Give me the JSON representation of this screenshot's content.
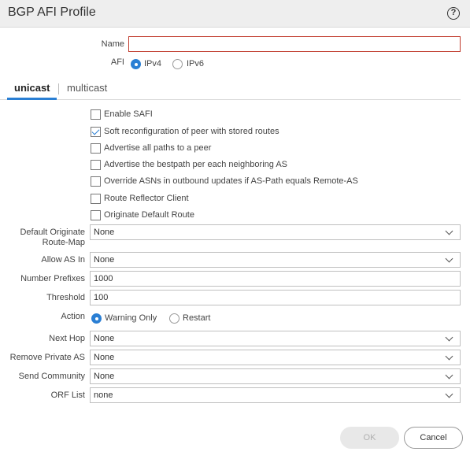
{
  "dialog": {
    "title": "BGP AFI Profile",
    "help_glyph": "?"
  },
  "form": {
    "name_label": "Name",
    "name_value": "",
    "afi_label": "AFI",
    "afi_options": [
      "IPv4",
      "IPv6"
    ],
    "afi_selected": "IPv4"
  },
  "tabs": [
    {
      "label": "unicast",
      "active": true
    },
    {
      "label": "multicast",
      "active": false
    }
  ],
  "checkboxes": [
    {
      "label": "Enable SAFI",
      "checked": false
    },
    {
      "label": "Soft reconfiguration of peer with stored routes",
      "checked": true
    },
    {
      "label": "Advertise all paths to a peer",
      "checked": false
    },
    {
      "label": "Advertise the bestpath per each neighboring AS",
      "checked": false
    },
    {
      "label": "Override ASNs in outbound updates if AS-Path equals Remote-AS",
      "checked": false
    },
    {
      "label": "Route Reflector Client",
      "checked": false
    },
    {
      "label": "Originate Default Route",
      "checked": false
    }
  ],
  "fields": {
    "default_originate_label_line1": "Default Originate",
    "default_originate_label_line2": "Route-Map",
    "default_originate_value": "None",
    "allow_as_in_label": "Allow AS In",
    "allow_as_in_value": "None",
    "number_prefixes_label": "Number Prefixes",
    "number_prefixes_value": "1000",
    "threshold_label": "Threshold",
    "threshold_value": "100",
    "action_label": "Action",
    "action_options": [
      "Warning Only",
      "Restart"
    ],
    "action_selected": "Warning Only",
    "next_hop_label": "Next Hop",
    "next_hop_value": "None",
    "remove_private_as_label": "Remove Private AS",
    "remove_private_as_value": "None",
    "send_community_label": "Send Community",
    "send_community_value": "None",
    "orf_list_label": "ORF List",
    "orf_list_value": "none"
  },
  "buttons": {
    "ok": "OK",
    "cancel": "Cancel"
  },
  "colors": {
    "accent": "#2a7fd4",
    "error_border": "#c0392b"
  }
}
